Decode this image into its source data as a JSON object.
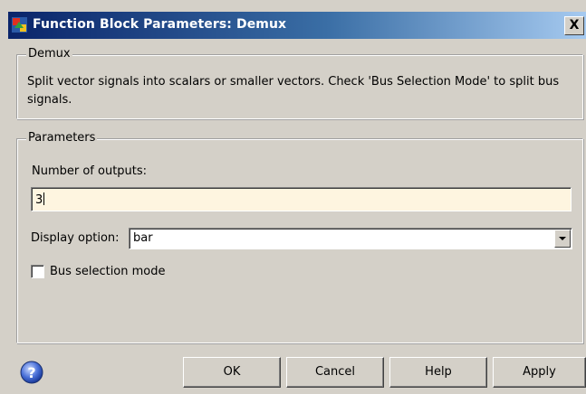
{
  "window": {
    "title": "Function Block Parameters: Demux",
    "close_glyph": "X"
  },
  "block": {
    "legend": "Demux",
    "description": "Split vector signals into scalars or smaller vectors. Check 'Bus Selection Mode' to split bus signals."
  },
  "parameters": {
    "legend": "Parameters",
    "num_outputs_label": "Number of outputs:",
    "num_outputs_value": "3",
    "display_option_label": "Display option:",
    "display_option_value": "bar",
    "bus_selection_label": "Bus selection mode",
    "bus_selection_checked": false
  },
  "buttons": {
    "ok": "OK",
    "cancel": "Cancel",
    "help": "Help",
    "apply": "Apply"
  },
  "icons": {
    "title": "simulink-block-icon",
    "help": "help-question-icon"
  },
  "colors": {
    "title_start": "#0a246a",
    "title_end": "#a6caf0",
    "dialog_bg": "#d4d0c8",
    "field_bg": "#fef5e0"
  }
}
